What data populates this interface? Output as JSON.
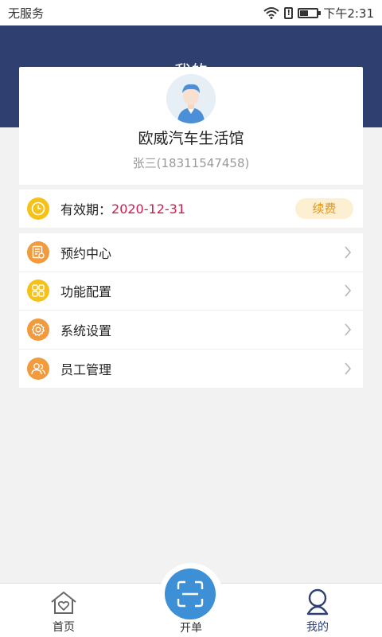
{
  "status_bar": {
    "carrier": "无服务",
    "time": "下午2:31"
  },
  "header": {
    "title": "我的"
  },
  "profile": {
    "store_name": "欧威汽车生活馆",
    "user_line": "张三(18311547458)"
  },
  "validity": {
    "label": "有效期：",
    "date": "2020-12-31",
    "renew_label": "续费",
    "accent_color": "#d3184b"
  },
  "menu": {
    "items": [
      {
        "label": "预约中心",
        "icon": "appointment-icon",
        "color": "#f19a3e"
      },
      {
        "label": "功能配置",
        "icon": "grid-icon",
        "color": "#f6c21a"
      },
      {
        "label": "系统设置",
        "icon": "gear-icon",
        "color": "#f19a3e"
      },
      {
        "label": "员工管理",
        "icon": "staff-icon",
        "color": "#f19a3e"
      }
    ]
  },
  "nav": {
    "home_label": "首页",
    "scan_label": "开单",
    "mine_label": "我的"
  },
  "colors": {
    "header_bg": "#2f4070",
    "scan_button": "#3d8fd6"
  }
}
